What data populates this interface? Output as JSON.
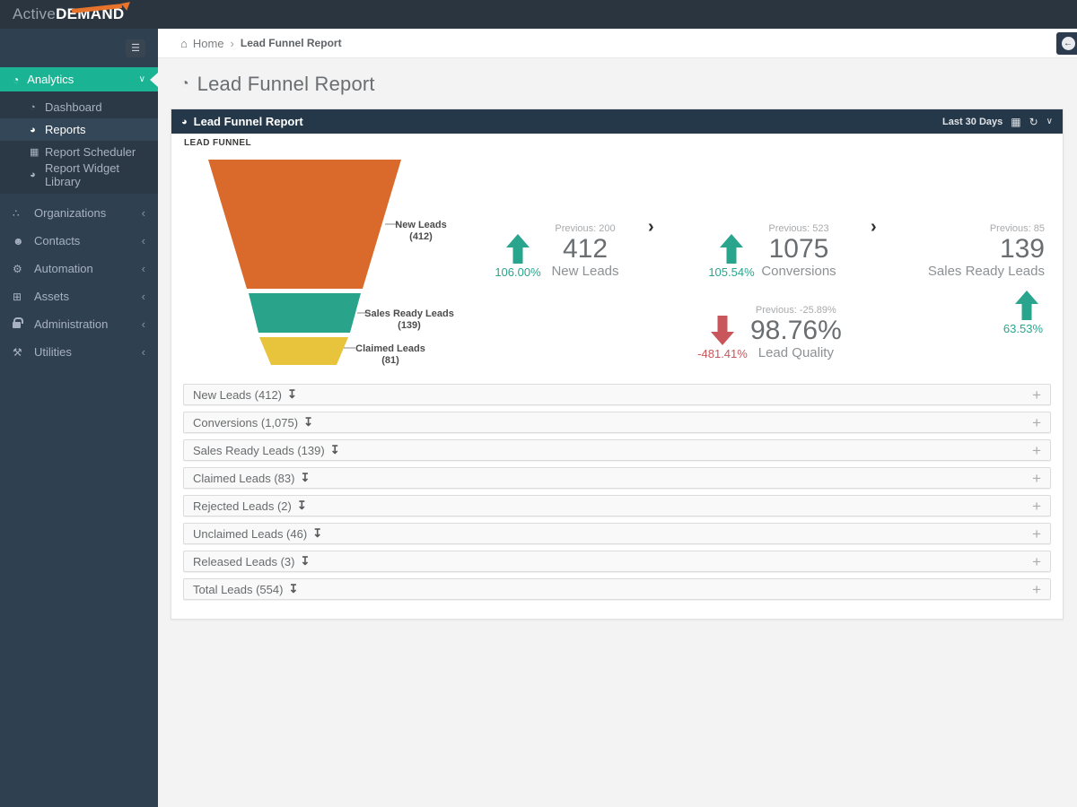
{
  "brand": {
    "name_light": "Active",
    "name_bold": "DEMAND"
  },
  "icons": {
    "hamburger": "☰",
    "gauge": "◔",
    "pie": "◕",
    "calendar": "▦",
    "sitemap": "∴",
    "users": "☻",
    "gears": "⚙",
    "wrench": "⚒",
    "grid": "⊞",
    "home": "⌂",
    "refresh": "↻",
    "download": "↧",
    "back": "←",
    "chevron_down": "∨",
    "chevron_left": "‹",
    "breadcrumb_sep": "›",
    "flow_sep": "›",
    "expand": "+"
  },
  "sidebar": {
    "analytics": {
      "label": "Analytics"
    },
    "submenu": [
      {
        "label": "Dashboard"
      },
      {
        "label": "Reports"
      },
      {
        "label": "Report Scheduler"
      },
      {
        "label": "Report Widget Library"
      }
    ],
    "sections": [
      {
        "label": "Organizations"
      },
      {
        "label": "Contacts"
      },
      {
        "label": "Automation"
      },
      {
        "label": "Assets"
      },
      {
        "label": "Administration"
      },
      {
        "label": "Utilities"
      }
    ]
  },
  "breadcrumb": {
    "home": "Home",
    "current": "Lead Funnel Report"
  },
  "page": {
    "title": "Lead Funnel Report"
  },
  "panel": {
    "title": "Lead Funnel Report",
    "date_range": "Last 30 Days",
    "section_label": "LEAD FUNNEL"
  },
  "chart_data": {
    "type": "funnel",
    "title": "LEAD FUNNEL",
    "stages": [
      {
        "label": "New Leads",
        "value": 412,
        "display": "(412)",
        "color": "#d96a2b"
      },
      {
        "label": "Sales Ready Leads",
        "value": 139,
        "display": "(139)",
        "color": "#29a48b"
      },
      {
        "label": "Claimed Leads",
        "value": 81,
        "display": "(81)",
        "color": "#e8c33c"
      }
    ]
  },
  "metrics": {
    "flow": [
      {
        "previous": "Previous: 200",
        "value": "412",
        "label": "New Leads",
        "change": "106.00%",
        "direction": "up"
      },
      {
        "previous": "Previous: 523",
        "value": "1075",
        "label": "Conversions",
        "change": "105.54%",
        "direction": "up"
      },
      {
        "previous": "Previous: 85",
        "value": "139",
        "label": "Sales Ready Leads",
        "change": "63.53%",
        "direction": "up"
      }
    ],
    "quality": {
      "previous": "Previous: -25.89%",
      "value": "98.76%",
      "label": "Lead Quality",
      "change": "-481.41%",
      "direction": "down"
    }
  },
  "accordion": {
    "rows": [
      {
        "label": "New Leads (412)"
      },
      {
        "label": "Conversions (1,075)"
      },
      {
        "label": "Sales Ready Leads (139)"
      },
      {
        "label": "Claimed Leads (83)"
      },
      {
        "label": "Rejected Leads (2)"
      },
      {
        "label": "Unclaimed Leads (46)"
      },
      {
        "label": "Released Leads (3)"
      },
      {
        "label": "Total Leads (554)"
      }
    ]
  },
  "colors": {
    "accent": "#1ab394",
    "sidebar_bg": "#2f4050",
    "topbar_bg": "#2b3540",
    "panel_header_bg": "#253849",
    "page_bg": "#f3f3f4",
    "up": "#2aa58d",
    "down": "#c9565a",
    "funnel_orange": "#d96a2b",
    "funnel_teal": "#29a48b",
    "funnel_yellow": "#e8c33c"
  }
}
